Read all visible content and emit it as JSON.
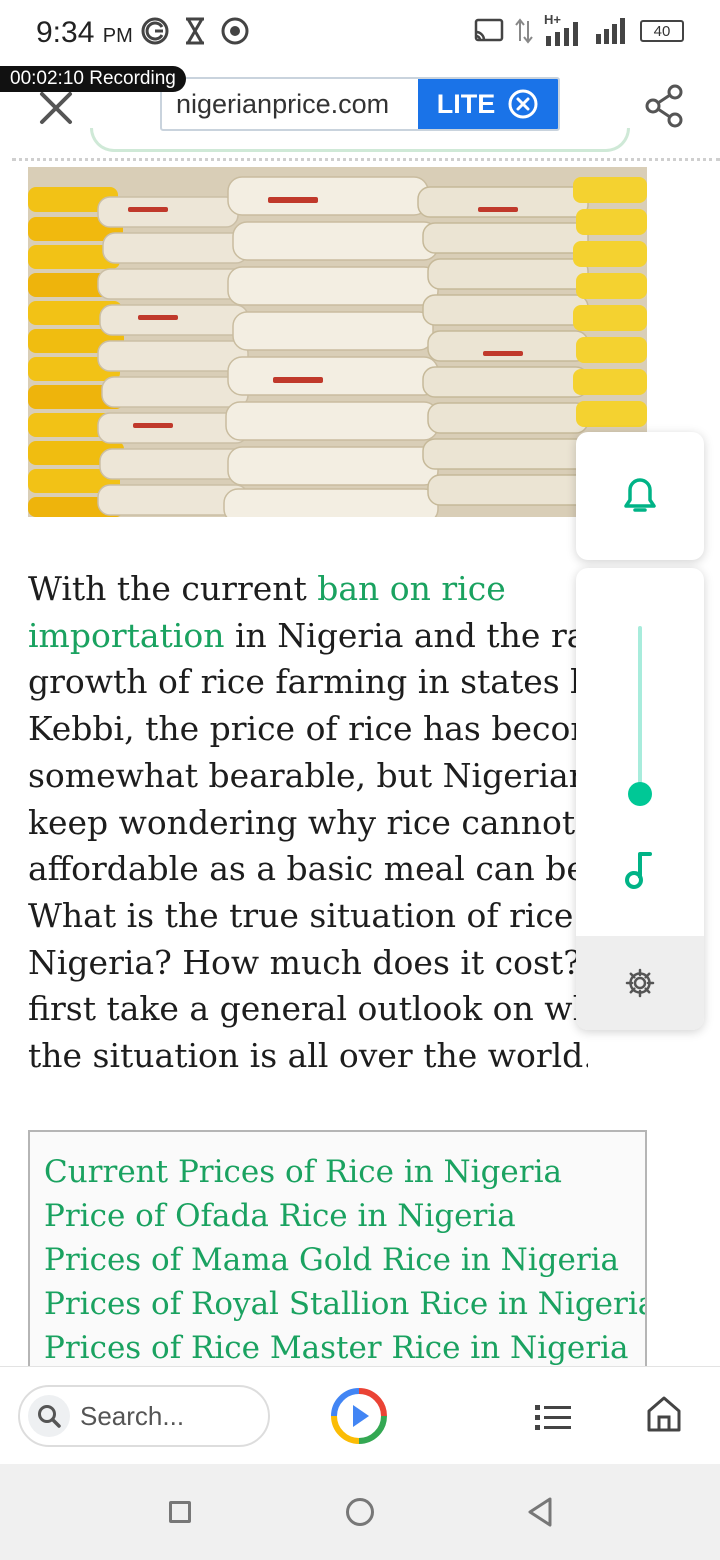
{
  "status_bar": {
    "time": "9:34",
    "ampm": "PM",
    "network": "H+",
    "battery": "40"
  },
  "recording": {
    "label": "00:02:10 Recording"
  },
  "toolbar": {
    "url": "nigerianprice.com",
    "lite_label": "LITE",
    "close_icon": "close-icon",
    "share_icon": "share-icon"
  },
  "hero_image": {
    "subject": "stacked rice bags",
    "colors": {
      "bag_white": "#efe7d8",
      "bag_yellow": "#f2c216",
      "bag_red_print": "#c0392b"
    }
  },
  "article": {
    "lines": [
      [
        "With the current ",
        "ban on rice"
      ],
      [
        "importation",
        " in Nigeria and the rap"
      ],
      [
        "growth of rice farming in states lik"
      ],
      [
        "Kebbi, the price of rice has become"
      ],
      [
        "somewhat bearable, but Nigerians"
      ],
      [
        "keep wondering why rice cannot b"
      ],
      [
        "affordable as a basic meal can be."
      ],
      [
        "What is the true situation of rice in"
      ],
      [
        "Nigeria? How much does it cost? L"
      ],
      [
        "first take a general outlook on wha"
      ],
      [
        "the situation is all over the world."
      ]
    ],
    "link_text": "ban on rice importation",
    "link_color": "#1aa260"
  },
  "toc": {
    "items": [
      "Current Prices of Rice in Nigeria",
      "Price of Ofada Rice in Nigeria",
      "Prices of Mama Gold Rice in Nigeria",
      "Prices of Royal Stallion Rice in Nigeria",
      "Prices of Rice Master Rice in Nigeria"
    ]
  },
  "floating_widgets": {
    "bell_icon": "bell-icon",
    "volume_level": 0.1,
    "music_icon": "music-note-icon",
    "settings_icon": "gear-icon",
    "accent": "#00c896"
  },
  "bottom_bar": {
    "search_placeholder": "Search...",
    "assistant_icon": "assistant-play-icon",
    "list_icon": "list-icon",
    "home_icon": "home-icon"
  },
  "system_nav": {
    "recents_icon": "recents-square-icon",
    "home_icon": "home-circle-icon",
    "back_icon": "back-triangle-icon"
  }
}
